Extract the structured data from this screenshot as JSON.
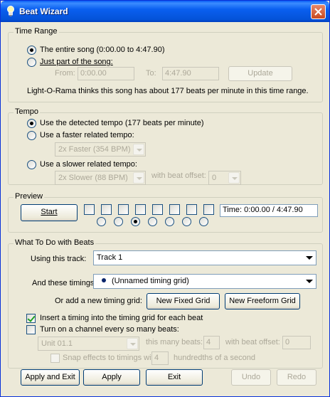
{
  "window": {
    "title": "Beat Wizard",
    "accent": "#0a5cf5"
  },
  "time_range": {
    "legend": "Time Range",
    "option_entire": "The entire song (0:00.00 to 4:47.90)",
    "option_part": "Just part of the song:",
    "from_label": "From:",
    "from_value": "0:00.00",
    "to_label": "To:",
    "to_value": "4:47.90",
    "update_button": "Update",
    "info": "Light-O-Rama thinks this song has about 177 beats per minute in this time range."
  },
  "tempo": {
    "legend": "Tempo",
    "option_detected": "Use the detected tempo (177 beats per minute)",
    "option_faster": "Use a faster related tempo:",
    "faster_value": "2x Faster (354 BPM)",
    "option_slower": "Use a slower related tempo:",
    "slower_value": "2x Slower (88 BPM)",
    "offset_label": "with beat offset:",
    "offset_value": "0"
  },
  "preview": {
    "legend": "Preview",
    "start_button": "Start",
    "beat_count": 8,
    "selected_beat": 3,
    "time_readout": "Time: 0:00.00 / 4:47.90"
  },
  "beats": {
    "legend": "What To Do with Beats",
    "track_label": "Using this track:",
    "track_value": "Track 1",
    "timings_label": "And these timings:",
    "timings_value": "(Unnamed timing grid)",
    "add_grid_label": "Or add a new timing grid:",
    "new_fixed_button": "New Fixed Grid",
    "new_freeform_button": "New Freeform Grid",
    "insert_timing_label": "Insert a timing into the timing grid for each beat",
    "insert_timing_checked": true,
    "channel_label": "Turn on a channel every so many beats:",
    "channel_checked": false,
    "unit_value": "Unit 01.1",
    "many_beats_label": "this many beats:",
    "many_beats_value": "4",
    "beat_offset_label": "with beat offset:",
    "beat_offset_value": "0",
    "snap_label": "Snap effects to timings within",
    "snap_value": "4",
    "snap_suffix": "hundredths of a second"
  },
  "footer": {
    "apply_exit": "Apply and Exit",
    "apply": "Apply",
    "exit": "Exit",
    "undo": "Undo",
    "redo": "Redo"
  }
}
